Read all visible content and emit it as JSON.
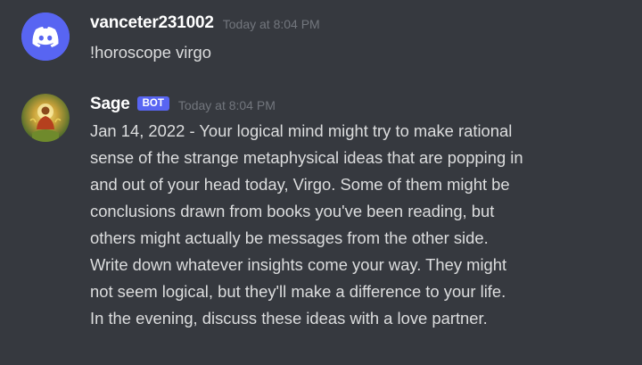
{
  "messages": [
    {
      "author": "vanceter231002",
      "timestamp": "Today at 8:04 PM",
      "avatar_icon": "discord-logo-icon",
      "content_lines": [
        "!horoscope virgo"
      ]
    },
    {
      "author": "Sage",
      "bot_tag": "BOT",
      "timestamp": "Today at 8:04 PM",
      "avatar_icon": "buddha-avatar-icon",
      "content_lines": [
        "Jan 14, 2022 - Your logical mind might try to make rational",
        "sense of the strange metaphysical ideas that are popping in",
        "and out of your head today, Virgo. Some of them might be",
        "conclusions drawn from books you've been reading, but",
        "others might actually be messages from the other side.",
        "Write down whatever insights come your way. They might",
        "not seem logical, but they'll make a difference to your life.",
        "In the evening, discuss these ideas with a love partner."
      ]
    }
  ],
  "colors": {
    "background": "#36393f",
    "username": "#ffffff",
    "text": "#dcddde",
    "timestamp": "#72767d",
    "blurple": "#5865f2"
  }
}
